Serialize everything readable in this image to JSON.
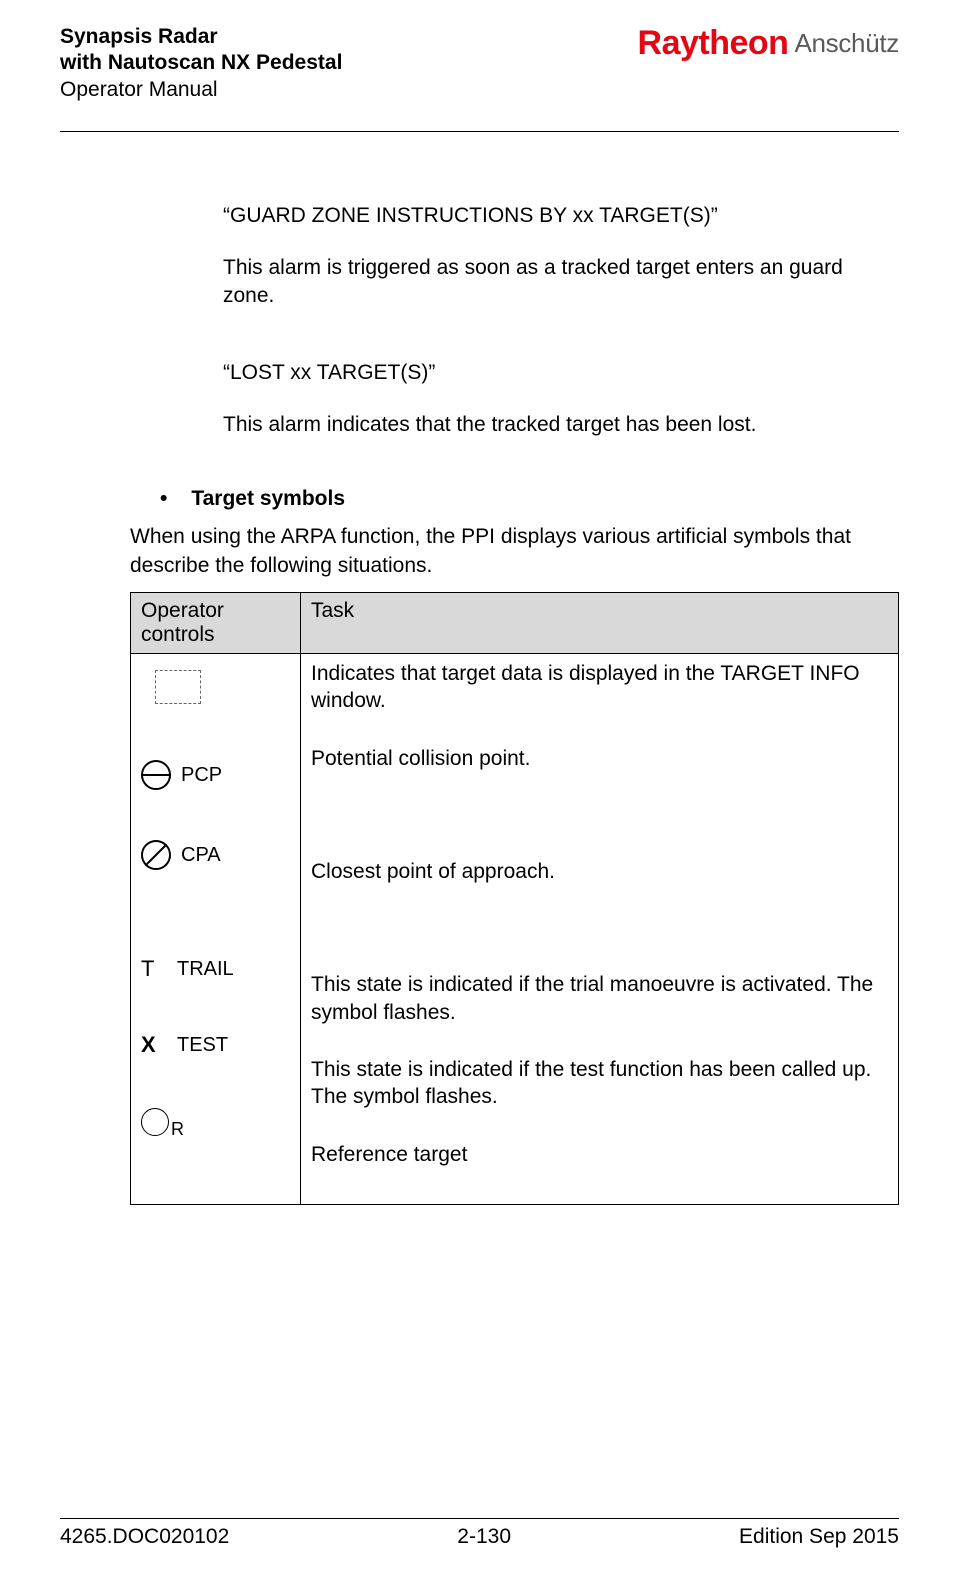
{
  "header": {
    "title_line1": "Synapsis Radar",
    "title_line2": "with Nautoscan NX Pedestal",
    "title_line3": "Operator Manual",
    "logo_main": "Raytheon",
    "logo_sub": "Anschütz"
  },
  "body": {
    "guard_title": "“GUARD ZONE INSTRUCTIONS BY xx TARGET(S)”",
    "guard_desc": "This alarm is triggered as soon as a tracked target enters an guard zone.",
    "lost_title": "“LOST xx TARGET(S)”",
    "lost_desc": "This alarm indicates that the tracked target has been lost.",
    "section_heading": "Target symbols",
    "section_intro": "When using the ARPA function, the PPI displays various artificial symbols that describe the following situations."
  },
  "table": {
    "header_controls": "Operator controls",
    "header_task": "Task",
    "rows": {
      "info": "Indicates that target data is displayed in the TARGET INFO window.",
      "pcp_label": "PCP",
      "pcp_task": "Potential collision point.",
      "cpa_label": "CPA",
      "cpa_task": "Closest point of approach.",
      "trail_sym": "T",
      "trail_label": "TRAIL",
      "trail_task": "This state is indicated if the trial manoeuvre is activated. The symbol flashes.",
      "test_sym": "X",
      "test_label": "TEST",
      "test_task": "This state is indicated if the test function has been called up. The symbol flashes.",
      "ref_sym": "R",
      "ref_task": "Reference target"
    }
  },
  "footer": {
    "doc_id": "4265.DOC020102",
    "page": "2-130",
    "edition": "Edition Sep 2015"
  }
}
